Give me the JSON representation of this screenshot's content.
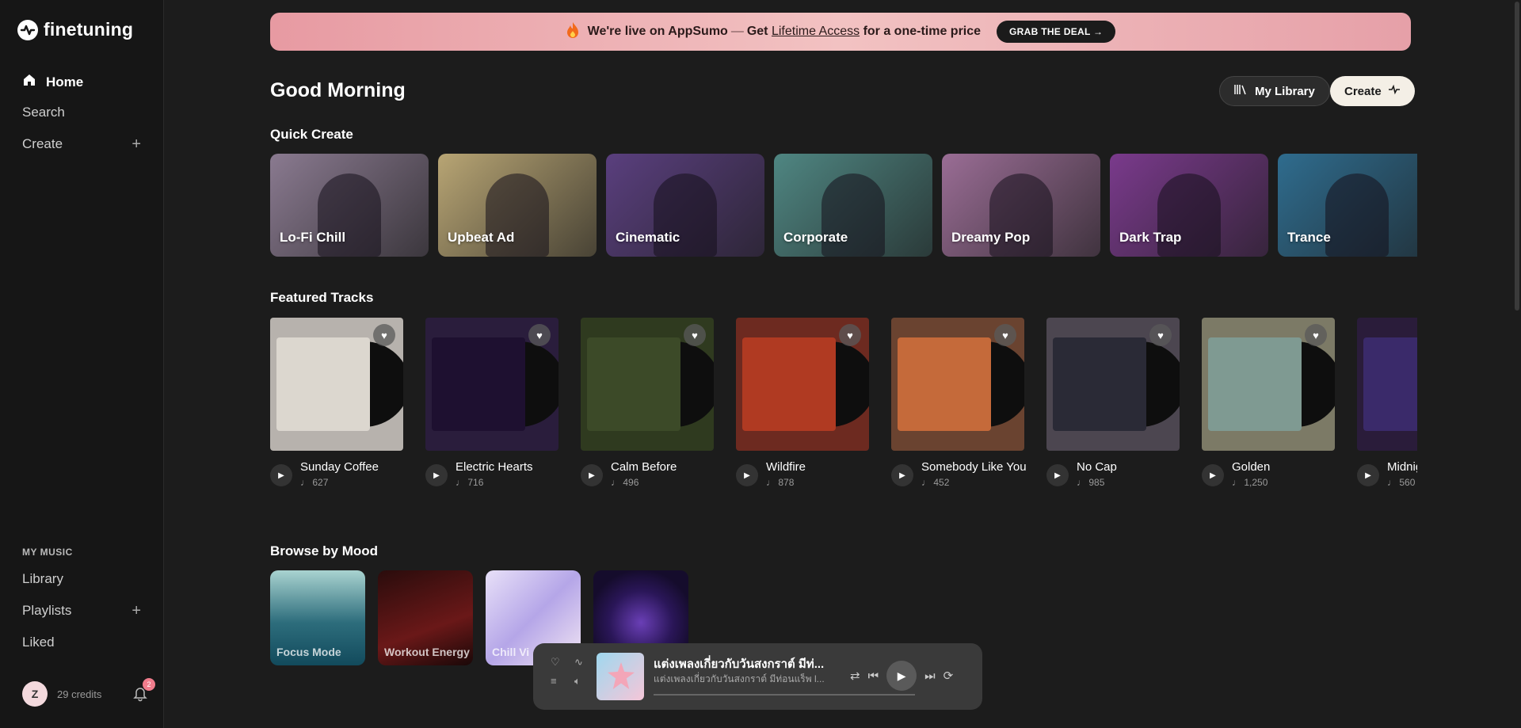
{
  "sidebar": {
    "brand": "finetuning",
    "nav": [
      {
        "label": "Home",
        "active": true
      },
      {
        "label": "Search"
      },
      {
        "label": "Create"
      }
    ],
    "section_label": "MY MUSIC",
    "music": [
      {
        "label": "Library"
      },
      {
        "label": "Playlists"
      },
      {
        "label": "Liked"
      }
    ],
    "avatar_initial": "Z",
    "credits": "29 credits"
  },
  "banner": {
    "text_a": "We're live on AppSumo",
    "dash": "—",
    "text_b": "Get",
    "text_link": "Lifetime Access",
    "text_c": "for a one-time price",
    "cta": "GRAB THE DEAL →"
  },
  "header": {
    "greeting": "Good Morning",
    "library_label": "My Library",
    "create_label": "Create"
  },
  "quick_create": {
    "title": "Quick Create",
    "items": [
      {
        "label": "Lo-Fi Chill",
        "bg": "#8a7a90"
      },
      {
        "label": "Upbeat Ad",
        "bg": "#b8a574"
      },
      {
        "label": "Cinematic",
        "bg": "#5a3f7e"
      },
      {
        "label": "Corporate",
        "bg": "#4f8682"
      },
      {
        "label": "Dreamy Pop",
        "bg": "#9a6d95"
      },
      {
        "label": "Dark Trap",
        "bg": "#7a3a8c"
      },
      {
        "label": "Trance",
        "bg": "#2f6c8e"
      }
    ]
  },
  "featured": {
    "title": "Featured Tracks",
    "items": [
      {
        "title": "Sunday Coffee",
        "count": "627",
        "bg": "#b7b2ad",
        "cover": "#dcd7cf"
      },
      {
        "title": "Electric Hearts",
        "count": "716",
        "bg": "#2a1d3c",
        "cover": "#1e1030"
      },
      {
        "title": "Calm Before",
        "count": "496",
        "bg": "#2f3a1f",
        "cover": "#3c4a28"
      },
      {
        "title": "Wildfire",
        "count": "878",
        "bg": "#6d2a20",
        "cover": "#b03a22"
      },
      {
        "title": "Somebody Like You",
        "count": "452",
        "bg": "#6a4330",
        "cover": "#c56a3a"
      },
      {
        "title": "No Cap",
        "count": "985",
        "bg": "#4c4650",
        "cover": "#2a2a36"
      },
      {
        "title": "Golden",
        "count": "1,250",
        "bg": "#7c7a66",
        "cover": "#7f9a92"
      },
      {
        "title": "Midnig",
        "count": "560",
        "bg": "#2a1c3a",
        "cover": "#3a2a6a"
      }
    ]
  },
  "mood": {
    "title": "Browse by Mood",
    "items": [
      {
        "label": "Focus Mode",
        "bg": "linear-gradient(180deg,#a9d3d0,#2d6d7c 55%,#124a5c)"
      },
      {
        "label": "Workout Energy",
        "bg": "linear-gradient(160deg,#2a0c0c,#6a1818 60%,#1a0808)"
      },
      {
        "label": "Chill Vi",
        "bg": "linear-gradient(135deg,#e8e0f8,#b5a6e8 50%,#f2e6f3)"
      },
      {
        "label": "",
        "bg": "radial-gradient(circle at 50% 55%,#6a3fb6,#2a1658 45%,#150c2c 75%)"
      }
    ]
  },
  "player": {
    "title": "แต่งเพลงเกี่ยวกับวันสงกราต์ มีท่...",
    "subtitle": "แต่งเพลงเกี่ยวกับวันสงกราต์ มีท่อนแร็พ l...",
    "progress": 0
  },
  "notifications": {
    "count": "2"
  }
}
